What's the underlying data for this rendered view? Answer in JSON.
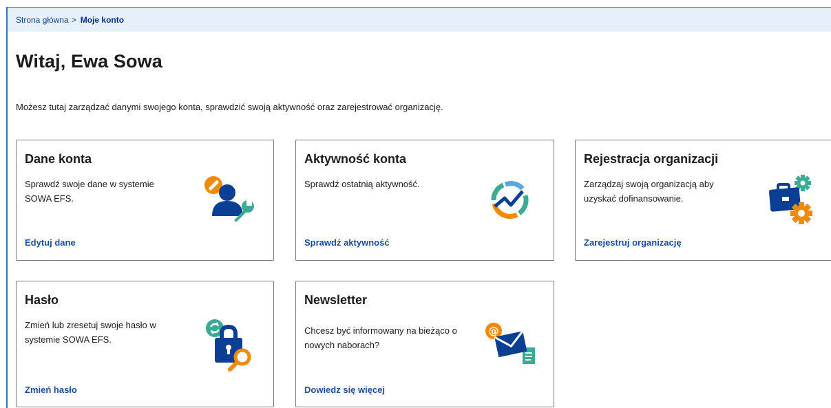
{
  "breadcrumb": {
    "home": "Strona główna",
    "separator": ">",
    "current": "Moje konto"
  },
  "page": {
    "title": "Witaj, Ewa Sowa",
    "intro": "Możesz tutaj zarządzać danymi swojego konta, sprawdzić swoją aktywność oraz zarejestrować organizację."
  },
  "cards": [
    {
      "title": "Dane konta",
      "desc_line1": "Sprawdź swoje dane w systemie",
      "desc_line2": "SOWA EFS.",
      "link": "Edytuj dane",
      "icon": "user-settings-icon"
    },
    {
      "title": "Aktywność konta",
      "desc_line1": "Sprawdź ostatnią aktywność.",
      "desc_line2": "",
      "link": "Sprawdź aktywność",
      "icon": "activity-chart-icon"
    },
    {
      "title": "Rejestracja organizacji",
      "desc_line1": "Zarządzaj swoją organizacją aby",
      "desc_line2": "uzyskać dofinansowanie.",
      "link": "Zarejestruj organizację",
      "icon": "briefcase-gears-icon"
    },
    {
      "title": "Hasło",
      "desc_line1": "Zmień lub zresetuj swoje hasło w",
      "desc_line2": "systemie SOWA EFS.",
      "link": "Zmień hasło",
      "icon": "padlock-search-icon"
    },
    {
      "title": "Newsletter",
      "desc_line1": "Chcesz być informowany na bieżąco o",
      "desc_line2": "nowych naborach?",
      "link": "Dowiedz się więcej",
      "icon": "email-newsletter-icon"
    }
  ],
  "colors": {
    "brand_blue": "#1a4d9c",
    "dark_blue": "#0b3f94",
    "orange": "#f08a00",
    "teal": "#3bab95",
    "breadcrumb_bg": "#e5f0fb"
  }
}
